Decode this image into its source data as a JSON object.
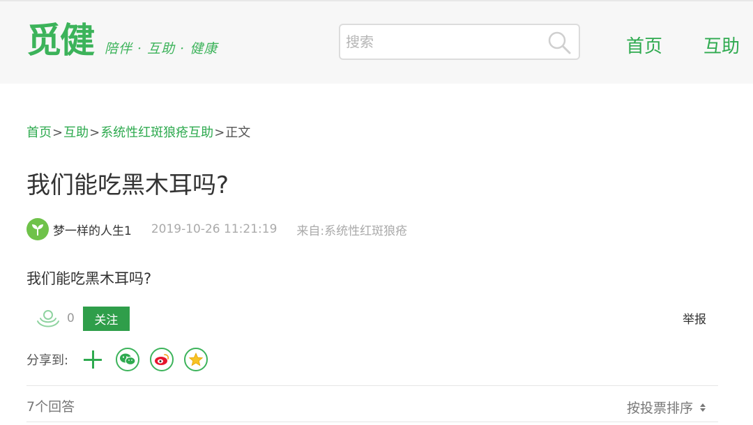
{
  "header": {
    "logo_text": "觅健",
    "slogan": "陪伴 · 互助 · 健康",
    "search_placeholder": "搜索",
    "nav": [
      "首页",
      "互助"
    ]
  },
  "breadcrumb": {
    "items": [
      "首页",
      "互助",
      "系统性红斑狼疮互助"
    ],
    "current": "正文",
    "separator": ">"
  },
  "post": {
    "title": "我们能吃黑木耳吗?",
    "author": "梦一样的人生1",
    "datetime": "2019-10-26 11:21:19",
    "source_label": "来自:",
    "source_name": "系统性红斑狼疮",
    "body": "我们能吃黑木耳吗?",
    "like_count": "0",
    "follow_label": "关注",
    "report_label": "举报"
  },
  "share": {
    "label": "分享到:",
    "icons": [
      "plus-icon",
      "wechat-icon",
      "weibo-icon",
      "qzone-icon"
    ]
  },
  "answers": {
    "count_label": "7个回答",
    "sort_label": "按投票排序"
  },
  "colors": {
    "brand_green": "#2eaa4f",
    "follow_button": "#2f9e4a",
    "header_bg": "#f7f7f7"
  }
}
